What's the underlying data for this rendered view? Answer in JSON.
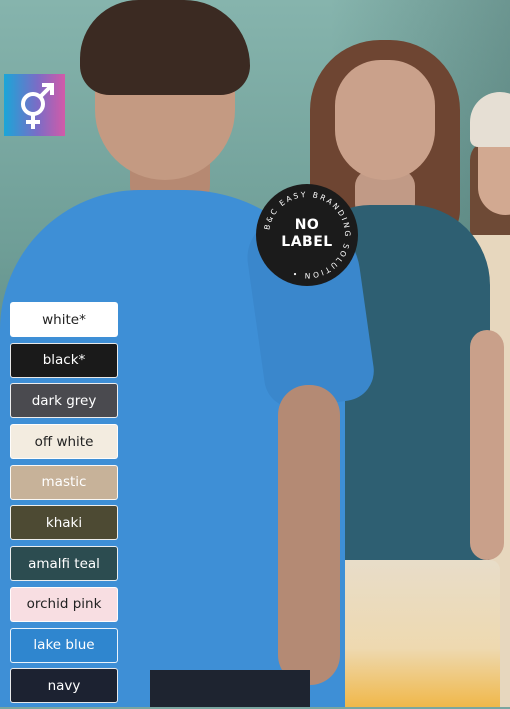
{
  "badge": {
    "icon": "gender-symbol-icon",
    "colors": [
      "#1aa6d8",
      "#7b6cc6",
      "#d35aa8"
    ]
  },
  "no_label_badge": {
    "main_line1": "NO",
    "main_line2": "LABEL",
    "ring_text": "B&C EASY BRANDING SOLUTION •"
  },
  "colors": [
    {
      "name": "white*",
      "bg": "#ffffff",
      "fg": "#222222"
    },
    {
      "name": "black*",
      "bg": "#1a1a1a",
      "fg": "#ffffff"
    },
    {
      "name": "dark grey",
      "bg": "#4a4a4f",
      "fg": "#ffffff"
    },
    {
      "name": "off white",
      "bg": "#f3ece0",
      "fg": "#222222"
    },
    {
      "name": "mastic",
      "bg": "#c7b299",
      "fg": "#ffffff"
    },
    {
      "name": "khaki",
      "bg": "#4d4a33",
      "fg": "#ffffff"
    },
    {
      "name": "amalfi teal",
      "bg": "#2c4c50",
      "fg": "#ffffff"
    },
    {
      "name": "orchid pink",
      "bg": "#f8dee2",
      "fg": "#222222"
    },
    {
      "name": "lake blue",
      "bg": "#2f86cf",
      "fg": "#ffffff"
    },
    {
      "name": "navy",
      "bg": "#1c2231",
      "fg": "#ffffff"
    }
  ]
}
